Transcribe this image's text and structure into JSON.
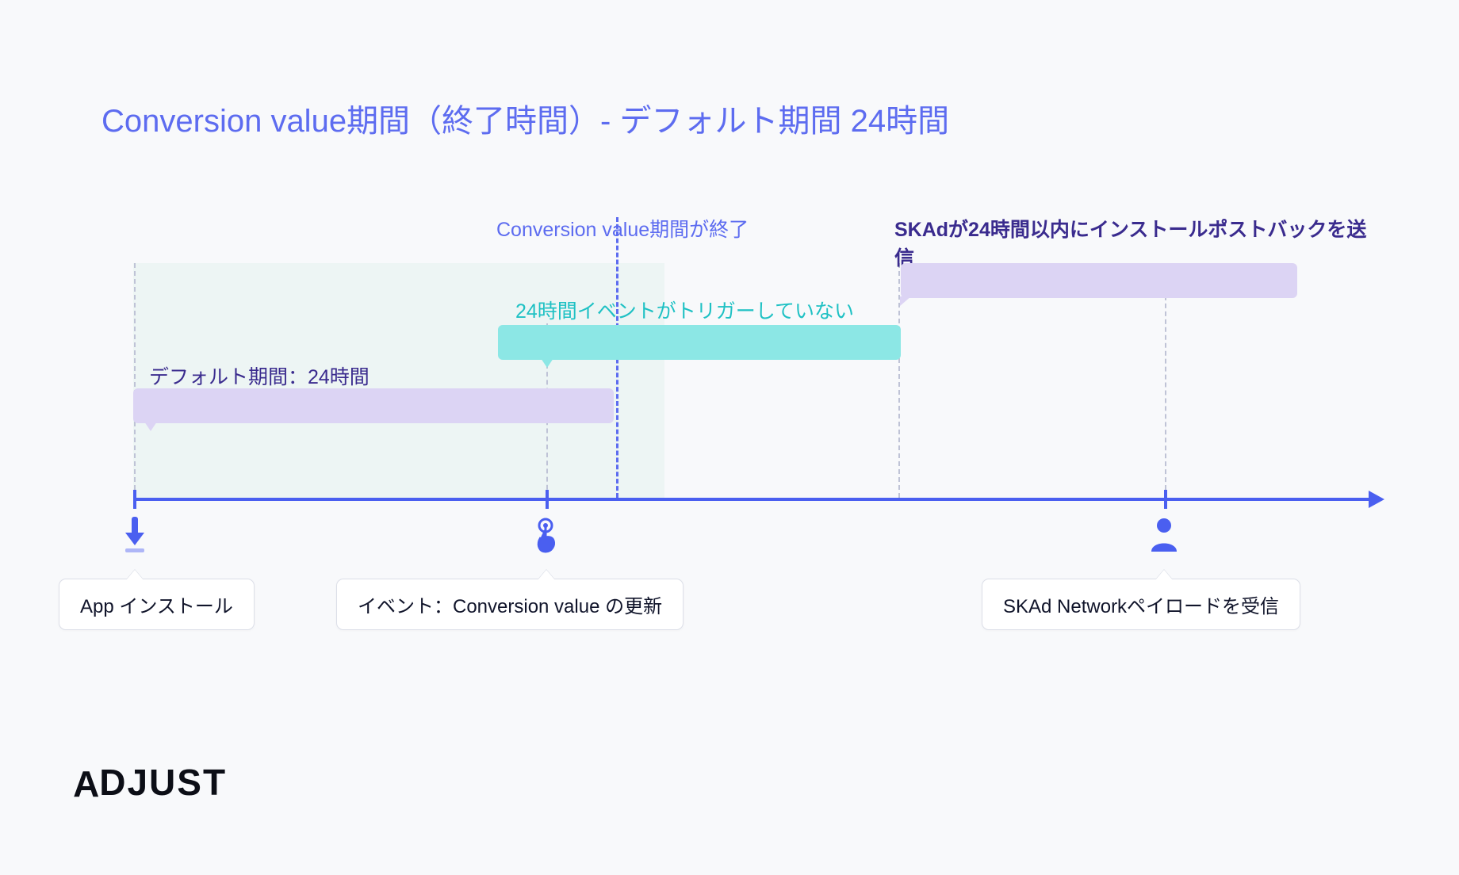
{
  "title": "Conversion value期間（終了時間）- デフォルト期間 24時間",
  "labels": {
    "cv_window_end": "Conversion value期間が終了",
    "skad_sends": "SKAdが24時間以内にインストールポストバックを送信",
    "default_period": "デフォルト期間：24時間",
    "no_event": "24時間イベントがトリガーしていない"
  },
  "events": {
    "install": "App インストール",
    "cv_update": "イベント：Conversion value の更新",
    "payload_received": "SKAd Networkペイロードを受信"
  },
  "logo": "ADJUST",
  "colors": {
    "primary": "#5d6cf0",
    "dark_purple": "#3a2b8e",
    "cyan": "#1fc1c4",
    "bar_purple": "#dcd4f4",
    "bar_cyan": "#8ce7e5"
  },
  "chart_data": {
    "type": "timeline",
    "title": "Conversion value期間（終了時間）- デフォルト期間 24時間",
    "events": [
      {
        "id": "install",
        "label": "App インストール",
        "t_hours": 0
      },
      {
        "id": "cv_update",
        "label": "イベント：Conversion value の更新",
        "t_hours": 12
      },
      {
        "id": "cv_window_end",
        "label": "Conversion value期間が終了",
        "t_hours": 14
      },
      {
        "id": "payload_received",
        "label": "SKAd Networkペイロードを受信",
        "t_hours": 30
      }
    ],
    "spans": [
      {
        "id": "default_period",
        "label": "デフォルト期間：24時間",
        "from_hours": 0,
        "to_hours": 14,
        "anchor": "install",
        "color": "#dcd4f4"
      },
      {
        "id": "no_event_24h",
        "label": "24時間イベントがトリガーしていない",
        "from_hours": 11,
        "to_hours": 23,
        "anchor": "cv_update",
        "color": "#8ce7e5"
      },
      {
        "id": "skad_postback_window",
        "label": "SKAdが24時間以内にインストールポストバックを送信",
        "from_hours": 23,
        "to_hours": 35,
        "anchor": "no_event_end",
        "color": "#dcd4f4"
      }
    ],
    "axis": {
      "unit": "hours",
      "range_approx": [
        0,
        36
      ]
    }
  }
}
